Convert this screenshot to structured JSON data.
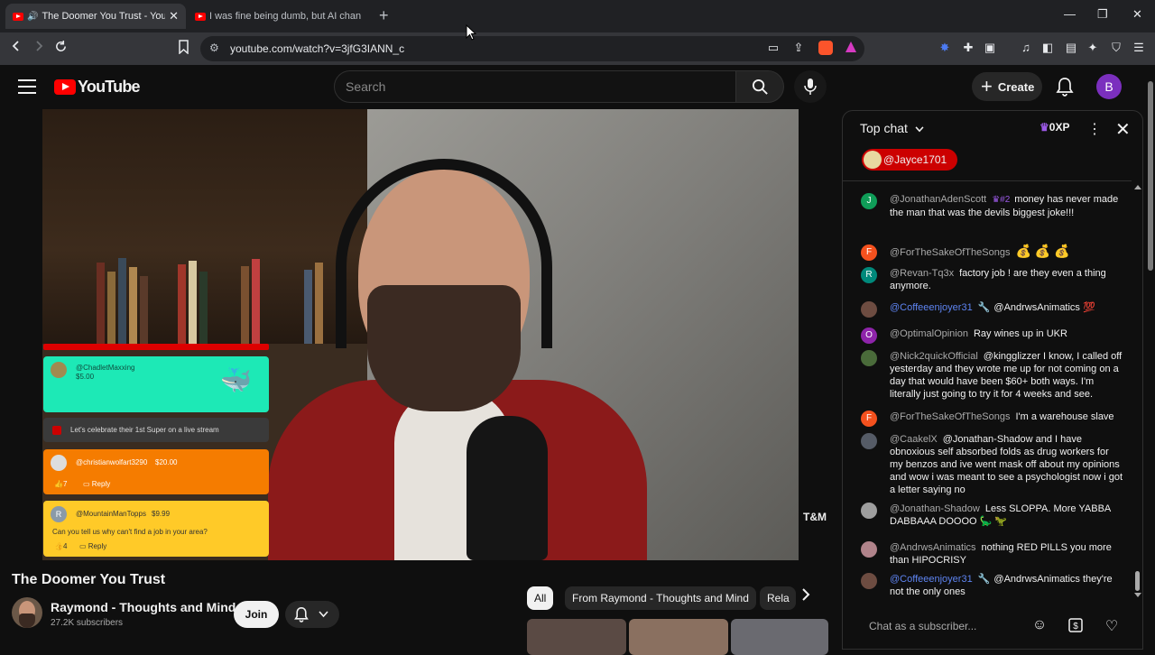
{
  "browser": {
    "tabs": [
      {
        "title": "The Doomer You Trust - YouTube",
        "active": true
      },
      {
        "title": "I was fine being dumb, but AI changed",
        "active": false
      }
    ],
    "url": "youtube.com/watch?v=3jfG3IANN_c"
  },
  "header": {
    "logo_text": "YouTube",
    "search_placeholder": "Search",
    "create_label": "Create",
    "avatar_letter": "B"
  },
  "overlay": {
    "card1_name": "@ChadletMaxxing",
    "card1_amount": "$5.00",
    "card2_text": "Let's celebrate their 1st Super on a live stream",
    "card3_name": "@christianwolfart3290",
    "card3_amount": "$20.00",
    "card3_likes": "7",
    "card3_reply": "Reply",
    "card4_name": "@MountainManTopps",
    "card4_amount": "$9.99",
    "card4_text": "Can you tell us why can't find a job in your area?",
    "card4_likes": "4",
    "card4_reply": "Reply",
    "card4_initial": "R",
    "watermark": "T&M"
  },
  "video": {
    "title": "The Doomer You Trust",
    "channel": "Raymond - Thoughts and Mind",
    "subscribers": "27.2K subscribers",
    "join_label": "Join"
  },
  "chips": [
    {
      "label": "All",
      "active": true
    },
    {
      "label": "From Raymond - Thoughts and Mind",
      "active": false
    },
    {
      "label": "Rela",
      "active": false
    }
  ],
  "chat": {
    "title": "Top chat",
    "xp": "0XP",
    "pinned_user": "@Jayce1701",
    "input_placeholder": "Chat as a subscriber...",
    "messages": [
      {
        "initial": "J",
        "color": "#0f9d58",
        "author": "@JonathanAdenScott",
        "badge": "#2",
        "text": "money has never made the man that was the devils biggest joke!!!",
        "mod": false
      },
      {
        "initial": "F",
        "color": "#f4511e",
        "author": "@ForTheSakeOfTheSongs",
        "text": "💰 💰 💰",
        "mod": false
      },
      {
        "initial": "R",
        "color": "#00897b",
        "author": "@Revan-Tq3x",
        "text": "factory job ! are they even a thing anymore.",
        "mod": false
      },
      {
        "initial": "",
        "color": "#6d4c41",
        "author": "@Coffeeenjoyer31",
        "text": "@AndrwsAnimatics 💯",
        "mod": true
      },
      {
        "initial": "O",
        "color": "#8e24aa",
        "author": "@OptimalOpinion",
        "text": "Ray wines up in UKR",
        "mod": false
      },
      {
        "initial": "",
        "color": "#4a6b3a",
        "author": "@Nick2quickOfficial",
        "text": "@kingglizzer I know, I called off yesterday and they wrote me up for not coming on a day that would have been $60+ both ways. I'm literally just going to try it for 4 weeks and see.",
        "mod": false
      },
      {
        "initial": "F",
        "color": "#f4511e",
        "author": "@ForTheSakeOfTheSongs",
        "text": "I'm a warehouse slave",
        "mod": false
      },
      {
        "initial": "",
        "color": "#555b66",
        "author": "@CaakelX",
        "text": "@Jonathan-Shadow and I have obnoxious self absorbed folds as drug workers for my benzos and ive went mask off about my opinions and wow i was meant to see a psychologist now i got a letter saying no",
        "mod": false
      },
      {
        "initial": "",
        "color": "#9e9e9e",
        "author": "@Jonathan-Shadow",
        "text": "Less SLOPPA. More YABBA DABBAAA DOOOO 🦕 🦖",
        "mod": false
      },
      {
        "initial": "",
        "color": "#b0838a",
        "author": "@AndrwsAnimatics",
        "text": "nothing RED PILLS you more than HIPOCRISY",
        "mod": false
      },
      {
        "initial": "",
        "color": "#6d4c41",
        "author": "@Coffeeenjoyer31",
        "text": "@AndrwsAnimatics they're not the only ones",
        "mod": true
      }
    ]
  }
}
